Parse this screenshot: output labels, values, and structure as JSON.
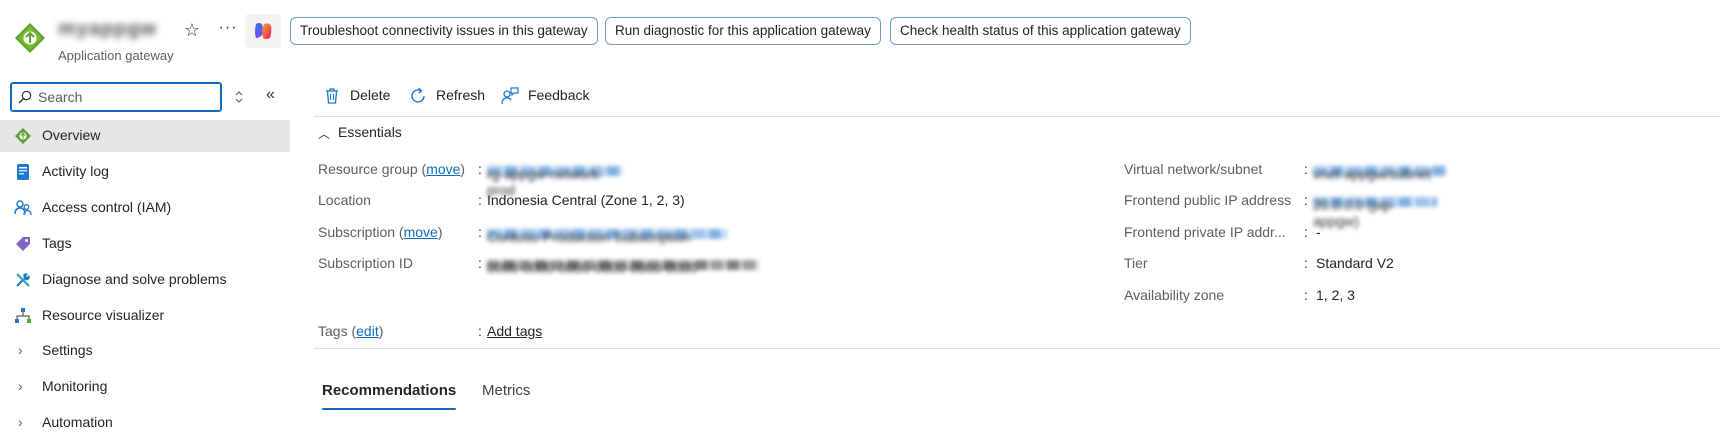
{
  "header": {
    "resource_name": "myappgw",
    "resource_type": "Application gateway",
    "chips": [
      "Troubleshoot connectivity issues in this gateway",
      "Run diagnostic for this application gateway",
      "Check health status of this application gateway"
    ],
    "more_label": "···"
  },
  "search": {
    "placeholder": "Search",
    "value": ""
  },
  "nav": {
    "items": [
      {
        "label": "Overview",
        "icon": "application-gateway-icon",
        "active": true
      },
      {
        "label": "Activity log",
        "icon": "activity-log-icon"
      },
      {
        "label": "Access control (IAM)",
        "icon": "people-icon"
      },
      {
        "label": "Tags",
        "icon": "tag-icon"
      },
      {
        "label": "Diagnose and solve problems",
        "icon": "wrench-icon"
      },
      {
        "label": "Resource visualizer",
        "icon": "hierarchy-icon"
      },
      {
        "label": "Settings",
        "icon": "chevron-right-icon"
      },
      {
        "label": "Monitoring",
        "icon": "chevron-right-icon"
      },
      {
        "label": "Automation",
        "icon": "chevron-right-icon"
      }
    ]
  },
  "commands": {
    "delete": "Delete",
    "refresh": "Refresh",
    "feedback": "Feedback"
  },
  "essentials": {
    "title": "Essentials",
    "left": [
      {
        "label": "Resource group",
        "link": "move",
        "value": "rg-appgw-network-prod"
      },
      {
        "label": "Location",
        "value": "Indonesia Central (Zone 1, 2, 3)"
      },
      {
        "label": "Subscription",
        "link": "move",
        "value": "Contoso Production Subscription"
      },
      {
        "label": "Subscription ID",
        "value": "0000-0000-0000-0000-0000-0000"
      }
    ],
    "right": [
      {
        "label": "Virtual network/subnet",
        "value": "vnet-appgw/subnet"
      },
      {
        "label": "Frontend public IP address",
        "value": "20.0.0.0 (pip-appgw)"
      },
      {
        "label": "Frontend private IP addr...",
        "value": "-"
      },
      {
        "label": "Tier",
        "value": "Standard V2"
      },
      {
        "label": "Availability zone",
        "value": "1, 2, 3"
      }
    ],
    "tags_label": "Tags",
    "tags_edit": "edit",
    "tags_add": "Add tags"
  },
  "tabs": [
    "Recommendations",
    "Metrics"
  ],
  "colors": {
    "accent": "#0f6cbd",
    "active_nav_bg": "#e6e6e6",
    "appgw_green": "#5ea130"
  }
}
